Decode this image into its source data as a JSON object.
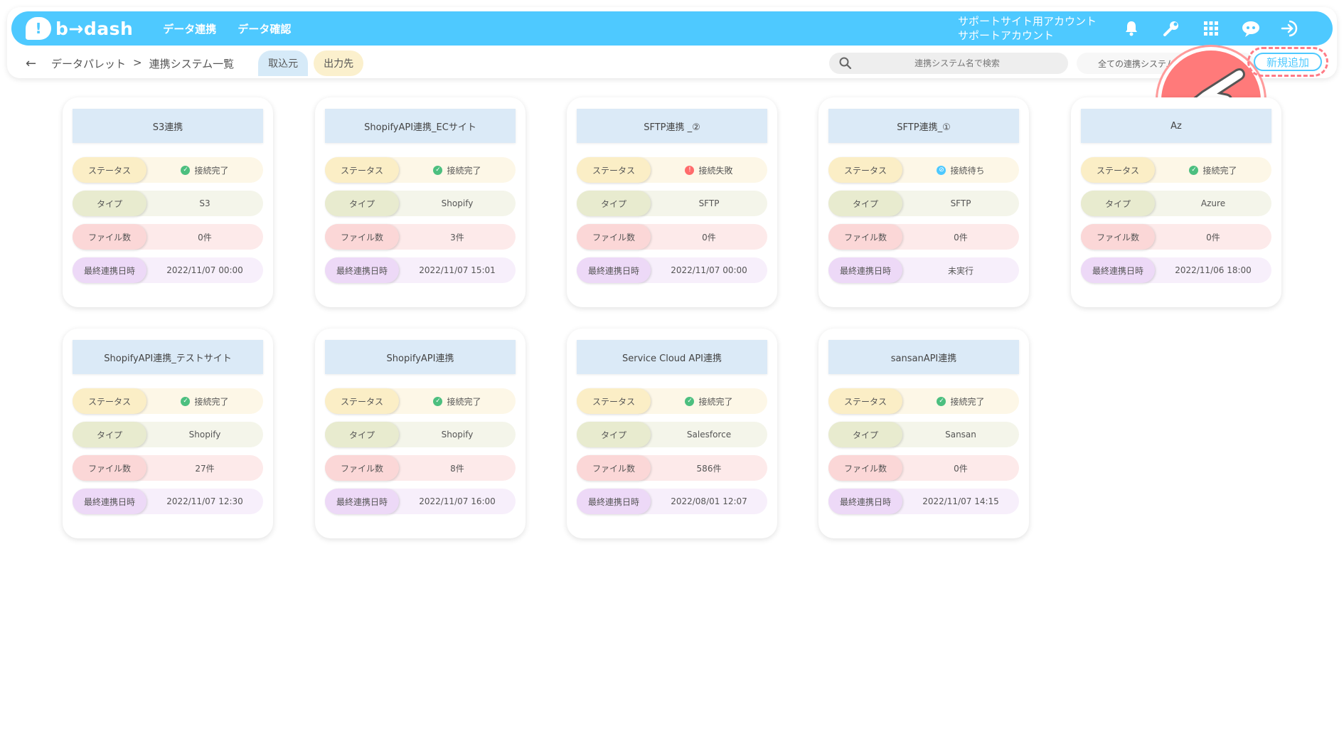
{
  "header": {
    "logo": "b→dash",
    "nav": [
      "データ連携",
      "データ確認"
    ],
    "account_line1": "サポートサイト用アカウント",
    "account_line2": "サポートアカウント"
  },
  "subbar": {
    "back_icon": "←",
    "breadcrumb": [
      "データパレット",
      ">",
      "連携システム一覧"
    ],
    "tab_in": "取込元",
    "tab_out": "出力先",
    "search_placeholder": "連携システム名で検索",
    "filter_label": "全ての連携システム",
    "new_button": "新規追加"
  },
  "labels": {
    "status": "ステータス",
    "type": "タイプ",
    "files": "ファイル数",
    "last": "最終連携日時"
  },
  "colors": {
    "accent": "#4ec9ff",
    "ok": "#4cbf7f",
    "error": "#ff6b6b",
    "waiting": "#4ec9ff"
  },
  "cards": [
    {
      "title": "S3連携",
      "status": "接続完了",
      "status_kind": "ok",
      "type": "S3",
      "files": "0件",
      "last": "2022/11/07 00:00"
    },
    {
      "title": "ShopifyAPI連携_ECサイト",
      "status": "接続完了",
      "status_kind": "ok",
      "type": "Shopify",
      "files": "3件",
      "last": "2022/11/07 15:01"
    },
    {
      "title": "SFTP連携 _②",
      "status": "接続失敗",
      "status_kind": "error",
      "type": "SFTP",
      "files": "0件",
      "last": "2022/11/07 00:00"
    },
    {
      "title": "SFTP連携_①",
      "status": "接続待ち",
      "status_kind": "waiting",
      "type": "SFTP",
      "files": "0件",
      "last": "未実行"
    },
    {
      "title": "Az",
      "status": "接続完了",
      "status_kind": "ok",
      "type": "Azure",
      "files": "0件",
      "last": "2022/11/06 18:00"
    },
    {
      "title": "ShopifyAPI連携_テストサイト",
      "status": "接続完了",
      "status_kind": "ok",
      "type": "Shopify",
      "files": "27件",
      "last": "2022/11/07 12:30"
    },
    {
      "title": "ShopifyAPI連携",
      "status": "接続完了",
      "status_kind": "ok",
      "type": "Shopify",
      "files": "8件",
      "last": "2022/11/07 16:00"
    },
    {
      "title": "Service Cloud API連携",
      "status": "接続完了",
      "status_kind": "ok",
      "type": "Salesforce",
      "files": "586件",
      "last": "2022/08/01 12:07"
    },
    {
      "title": "sansanAPI連携",
      "status": "接続完了",
      "status_kind": "ok",
      "type": "Sansan",
      "files": "0件",
      "last": "2022/11/07 14:15"
    }
  ]
}
